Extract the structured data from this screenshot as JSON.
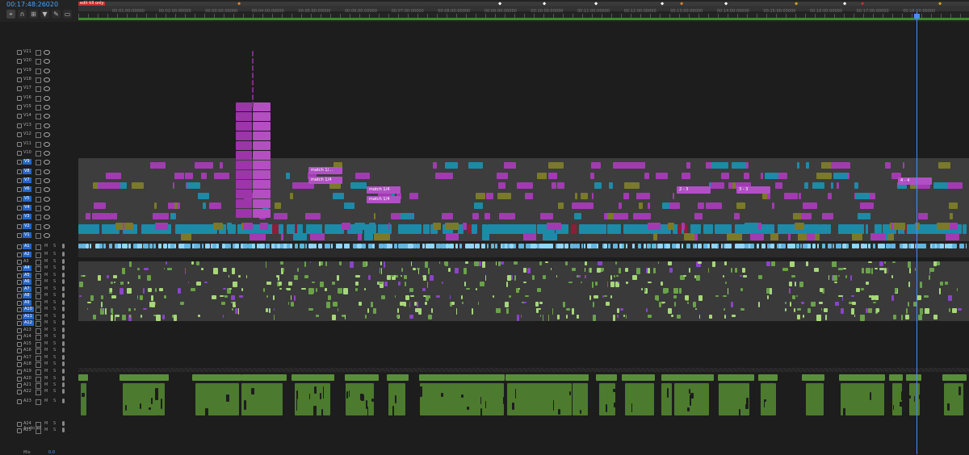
{
  "header": {
    "timecode": "00:17:48:26020",
    "sequence_label": "edit till only",
    "tools": [
      "snap-icon",
      "linked-selection-icon",
      "marker-icon",
      "wrench-icon",
      "captions-icon"
    ]
  },
  "ruler": {
    "ticks": [
      "00:01:00:00000",
      "00:02:00:00000",
      "00:03:00:00000",
      "00:04:00:00000",
      "00:05:00:00000",
      "00:06:00:00000",
      "00:07:00:00000",
      "00:08:00:00000",
      "00:09:00:00000",
      "00:10:00:00000",
      "00:11:00:00000",
      "00:12:00:00000",
      "00:13:00:00000",
      "00:14:00:00000",
      "00:15:00:00000",
      "00:16:00:00000",
      "00:17:00:00000",
      "00:18:00:00000"
    ]
  },
  "video_tracks": [
    "V21",
    "V20",
    "V19",
    "V18",
    "V17",
    "V16",
    "V15",
    "V14",
    "V13",
    "V12",
    "V11",
    "V10",
    "V9",
    "V8",
    "V7",
    "V6",
    "V5",
    "V4",
    "V3",
    "V2",
    "V1"
  ],
  "active_video_tracks": [
    "V9",
    "V8",
    "V7",
    "V6",
    "V5",
    "V4",
    "V3",
    "V2",
    "V1"
  ],
  "audio_tracks": [
    "A1",
    "A2",
    "A3",
    "A4",
    "A5",
    "A6",
    "A7",
    "A8",
    "A9",
    "A10",
    "A11",
    "A12",
    "A13",
    "A14",
    "A15",
    "A16",
    "A17",
    "A18",
    "A19",
    "A20",
    "A21",
    "A22",
    "A23",
    "A24",
    "A25"
  ],
  "active_audio_tracks": [
    "A1",
    "A2",
    "A4",
    "A5",
    "A6",
    "A7",
    "A8",
    "A9",
    "A10",
    "A11",
    "A12"
  ],
  "audio23_name": "Audio 23",
  "mix": {
    "label": "Mix",
    "value": "0.0"
  },
  "clip_labels": [
    "match 1/...",
    "match 1/4",
    "match 1/4",
    "match 1/4",
    "2 - 3",
    "3 - 3",
    "4 - 4",
    "fx"
  ],
  "colors": {
    "accent": "#4aa3ff",
    "video_magenta": "#a23bb1",
    "video_cyan": "#1d8aa8",
    "audio_green": "#5a8f3a",
    "playhead": "#4a8cff",
    "render_green": "#3a8a2a",
    "active_track": "#2566c7"
  }
}
